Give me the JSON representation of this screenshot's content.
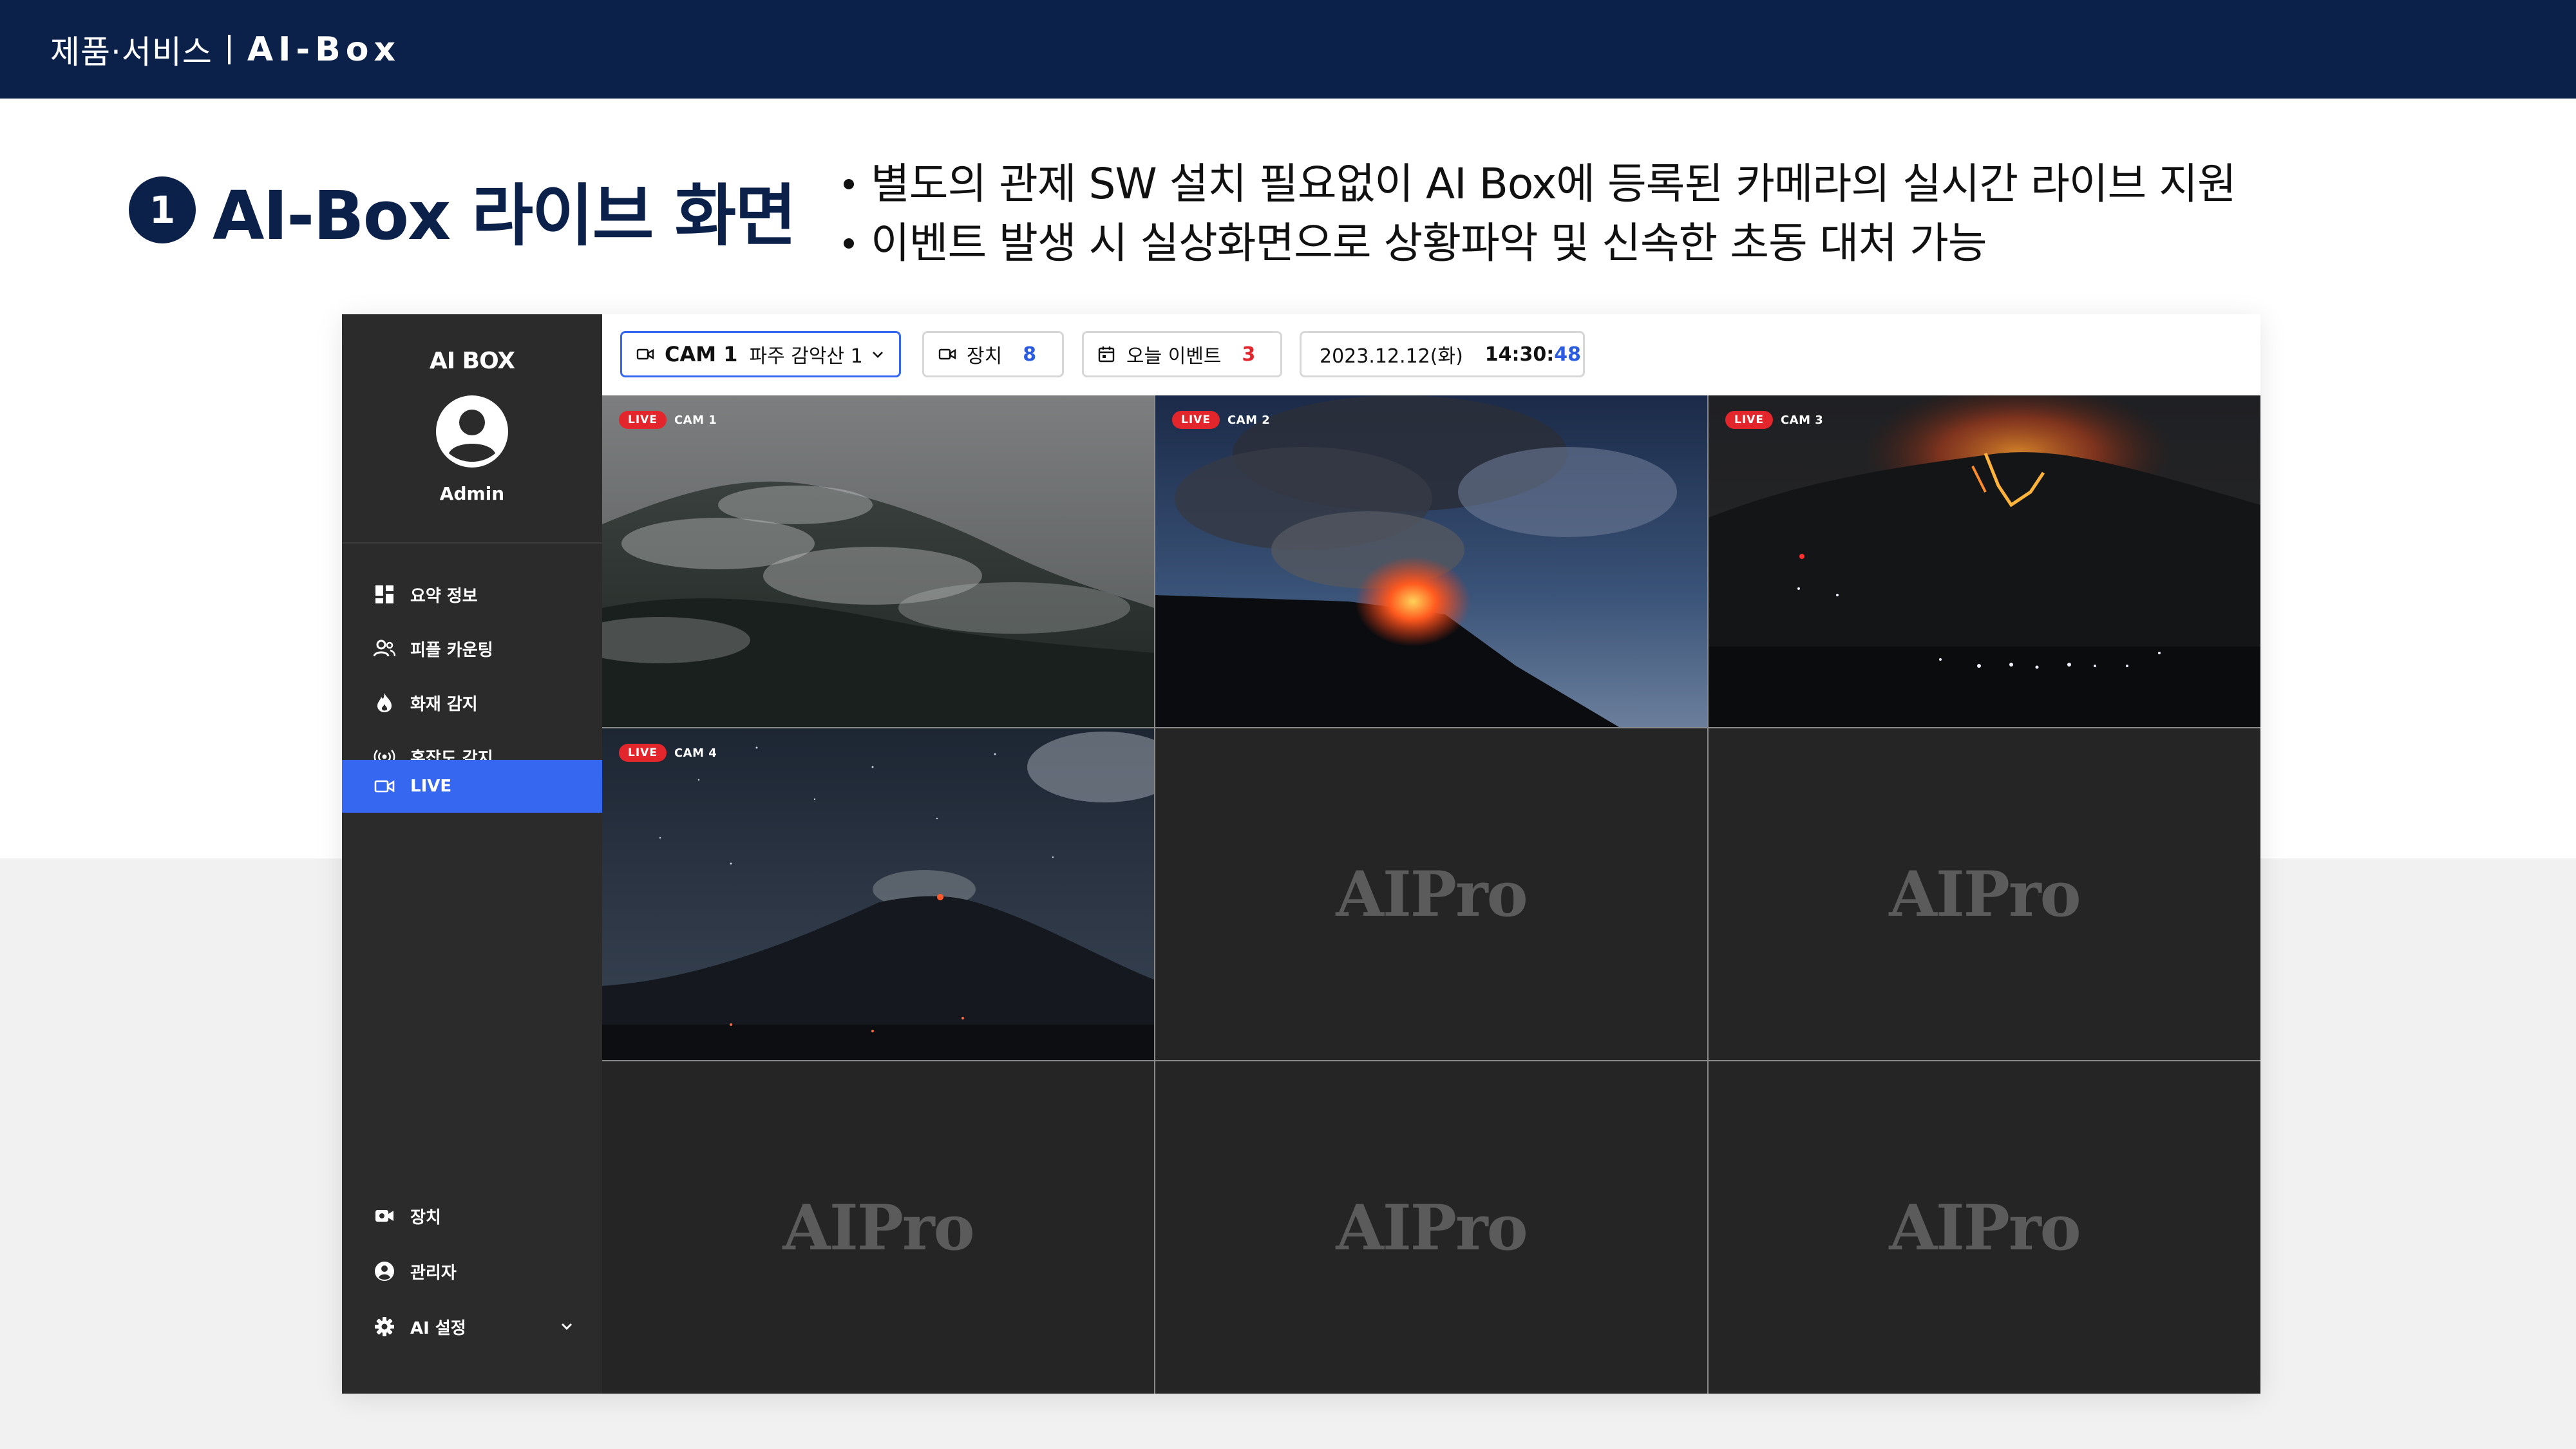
{
  "banner": {
    "category": "제품·서비스",
    "product": "AI-Box"
  },
  "heading": {
    "number": "1",
    "title": "AI-Box 라이브 화면"
  },
  "bullets": [
    "별도의 관제 SW 설치 필요없이 AI Box에 등록된 카메라의 실시간 라이브 지원",
    "이벤트 발생 시 실상화면으로 상황파악 및 신속한 초동 대처 가능"
  ],
  "sidebar": {
    "brand": "AI BOX",
    "user": "Admin",
    "nav": [
      {
        "label": "요약 정보",
        "icon": "dashboard-icon"
      },
      {
        "label": "피플 카운팅",
        "icon": "people-icon"
      },
      {
        "label": "화재 감지",
        "icon": "flame-icon"
      },
      {
        "label": "혼잡도 감지",
        "icon": "broadcast-icon"
      },
      {
        "label": "LIVE",
        "icon": "video-camera-icon",
        "active": true
      }
    ],
    "bottom_nav": [
      {
        "label": "장치",
        "icon": "device-camera-icon"
      },
      {
        "label": "관리자",
        "icon": "admin-user-icon"
      },
      {
        "label": "AI 설정",
        "icon": "gear-icon"
      }
    ]
  },
  "toolbar": {
    "camera": {
      "name": "CAM 1",
      "location": "파주 감악산 1"
    },
    "devices": {
      "label": "장치",
      "count": "8"
    },
    "events": {
      "label": "오늘 이벤트",
      "count": "3"
    },
    "date": "2023.12.12(화)",
    "time_hm": "14:30:",
    "time_s": "48"
  },
  "grid": {
    "live_label": "LIVE",
    "cameras": [
      "CAM 1",
      "CAM 2",
      "CAM 3",
      "CAM 4"
    ],
    "placeholder": "AIPro"
  },
  "colors": {
    "navy": "#0c214a",
    "accent": "#3567f0",
    "live_red": "#e3262b",
    "sidebar": "#2b2b2b"
  }
}
